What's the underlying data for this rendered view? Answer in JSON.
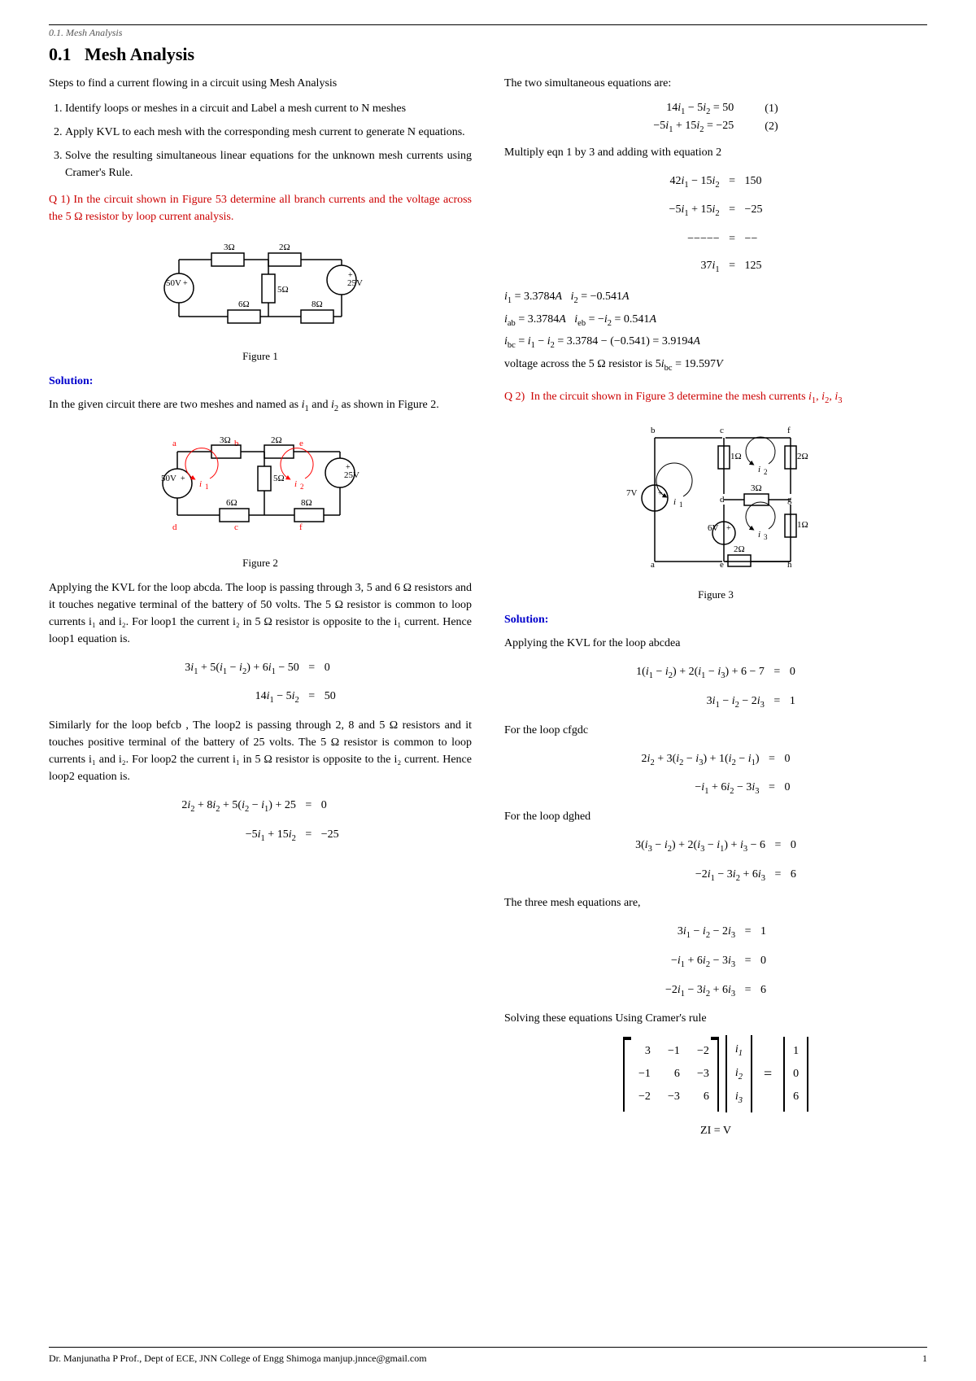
{
  "header": {
    "text": "0.1.  Mesh Analysis"
  },
  "footer": {
    "text": "Dr. Manjunatha P Prof., Dept of ECE, JNN College of Engg Shimoga manjup.jnnce@gmail.com",
    "page": "1"
  },
  "section": {
    "number": "0.1",
    "title": "Mesh Analysis"
  },
  "intro_text": "Steps to find a current flowing in a circuit using Mesh Analysis",
  "steps": [
    "Identify loops or meshes in a circuit and Label a mesh current to N meshes",
    "Apply KVL to each mesh with the corresponding mesh current to generate N equations.",
    "Solve the resulting simultaneous linear equations for the unknown mesh currents using Cramer's Rule."
  ],
  "q1": {
    "text": "Q 1)  In the circuit shown in Figure 53 determine all branch currents and the voltage across the 5 Ω resistor by loop current analysis.",
    "fig1_caption": "Figure 1",
    "fig2_caption": "Figure 2",
    "solution_label": "Solution:",
    "solution_text": "In the given circuit there are two meshes and named as i₁ and i₂ as shown in Figure 2.",
    "kvl_text": "Applying the KVL for the loop abcda. The loop is passing through 3, 5 and 6 Ω resistors and it touches negative terminal of the battery of 50 volts. The 5 Ω resistor is common to loop currents i₁ and i₂. For loop1 the current i₂ in 5 Ω resistor is opposite to the i₁ current. Hence loop1 equation is.",
    "loop1_eq1": "3i₁ + 5(i₁ − i₂) + 6i₁ − 50  =  0",
    "loop1_eq2": "14i₁ − 5i₂  =  50",
    "loop2_text": "Similarly for the loop befcb , The loop2 is passing through 2, 8 and 5 Ω resistors and it touches positive terminal of the battery of 25 volts. The 5 Ω resistor is common to loop currents i₁ and i₂. For loop2 the current i₁ in 5 Ω resistor is opposite to the i₂ current. Hence loop2 equation is.",
    "loop2_eq1": "2i₂ + 8i₂ + 5(i₂ − i₁) + 25  =  0",
    "loop2_eq2": "−5i₁ + 15i₂  =  −25"
  },
  "right_col": {
    "simul_text": "The two simultaneous equations are:",
    "eq1": "14i₁ − 5i₂ = 50",
    "eq1_num": "(1)",
    "eq2": "−5i₁ + 15i₂ = −25",
    "eq2_num": "(2)",
    "multiply_text": "Multiply eqn 1 by 3 and adding with equation 2",
    "system": [
      {
        "lhs": "42i₁ − 15i₂",
        "op": "=",
        "rhs": "150"
      },
      {
        "lhs": "−5i₁ + 15i₂",
        "op": "=",
        "rhs": "−25"
      },
      {
        "lhs": "−−−−−",
        "op": "=",
        "rhs": "−−"
      },
      {
        "lhs": "37i₁",
        "op": "=",
        "rhs": "125"
      }
    ],
    "results": [
      "i₁ = 3.3784A   i₂ = −0.541A",
      "i₂ₓ = 3.3784A   iₑₓ = −i₂ = 0.541A",
      "iₓ⁣ = i₁ − i₂ = 3.3784 − (−0.541) = 3.9194A",
      "voltage across the 5 Ω resistor is 5iₓ⁣ = 19.597V"
    ],
    "q2": {
      "text": "Q 2)  In the circuit shown in Figure 3 determine the mesh currents i₁, i₂, i₃",
      "fig3_caption": "Figure 3",
      "solution_label": "Solution:",
      "kvl_abcdea": "Applying the KVL for the loop abcdea",
      "loop_abcdea_eq1": "1(i₁ − i₂) + 2(i₁ − i₃) + 6 − 7  =  0",
      "loop_abcdea_eq2": "3i₁ − i₂ − 2i₃  =  1",
      "loop_cfgdc": "For the loop cfgdc",
      "loop_cfgdc_eq1": "2i₂ + 3(i₂ − i₃) + 1(i₂ − i₁)  =  0",
      "loop_cfgdc_eq2": "−i₁ + 6i₂ − 3i₃  =  0",
      "loop_dghed": "For the loop dghed",
      "loop_dghed_eq1": "3(i₃ − i₂) + 2(i₃ − i₁) + i₃ − 6  =  0",
      "loop_dghed_eq2": "−2i₁ − 3i₂ + 6i₃  =  6",
      "three_mesh_text": "The three mesh equations are,",
      "three_mesh": [
        "3i₁ − i₂ − 2i₃  =  1",
        "−i₁ + 6i₂ − 3i₃  =  0",
        "−2i₁ − 3i₂ + 6i₃  =  6"
      ],
      "cramer_text": "Solving these equations Using Cramer's rule",
      "matrix_Z": [
        [
          3,
          -1,
          -2
        ],
        [
          -1,
          6,
          -3
        ],
        [
          -2,
          -3,
          6
        ]
      ],
      "matrix_I": [
        [
          "i₁"
        ],
        [
          "i₂"
        ],
        [
          "i₃"
        ]
      ],
      "matrix_V": [
        [
          1
        ],
        [
          0
        ],
        [
          6
        ]
      ],
      "zi_v": "ZI = V"
    }
  }
}
